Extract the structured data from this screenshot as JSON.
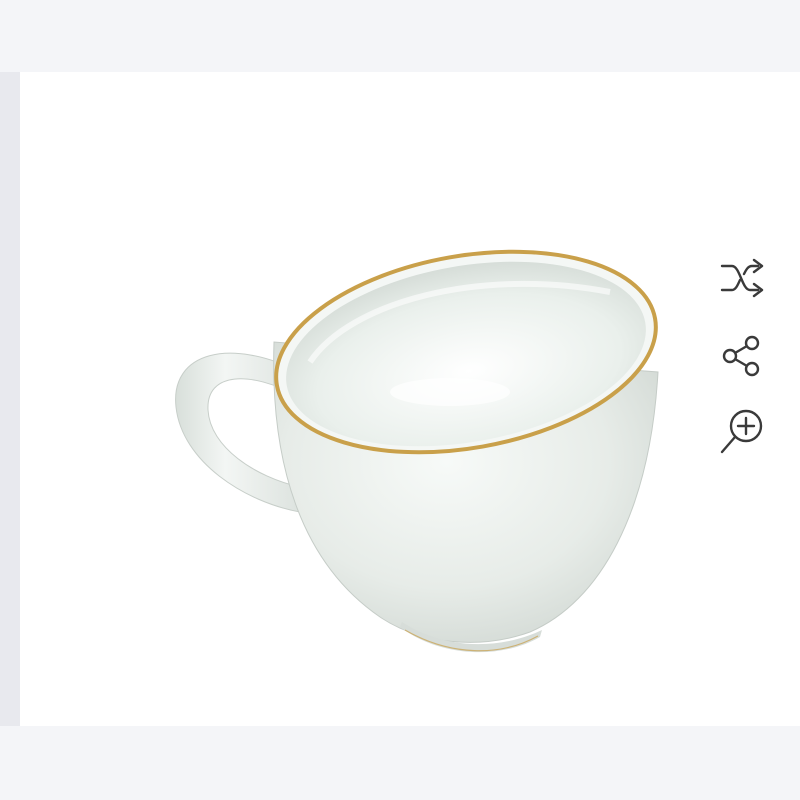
{
  "product": {
    "image": "white-porcelain-cup-gold-rim",
    "colors": {
      "background": "#f4f5f8",
      "frame": "#ffffff",
      "porcelain": "#eef2ef",
      "gold_rim": "#c9a04a",
      "icon": "#3a3a3a"
    }
  },
  "actions": [
    {
      "name": "compare",
      "icon": "shuffle-arrows-icon"
    },
    {
      "name": "share",
      "icon": "share-icon"
    },
    {
      "name": "zoom",
      "icon": "zoom-in-icon"
    }
  ]
}
